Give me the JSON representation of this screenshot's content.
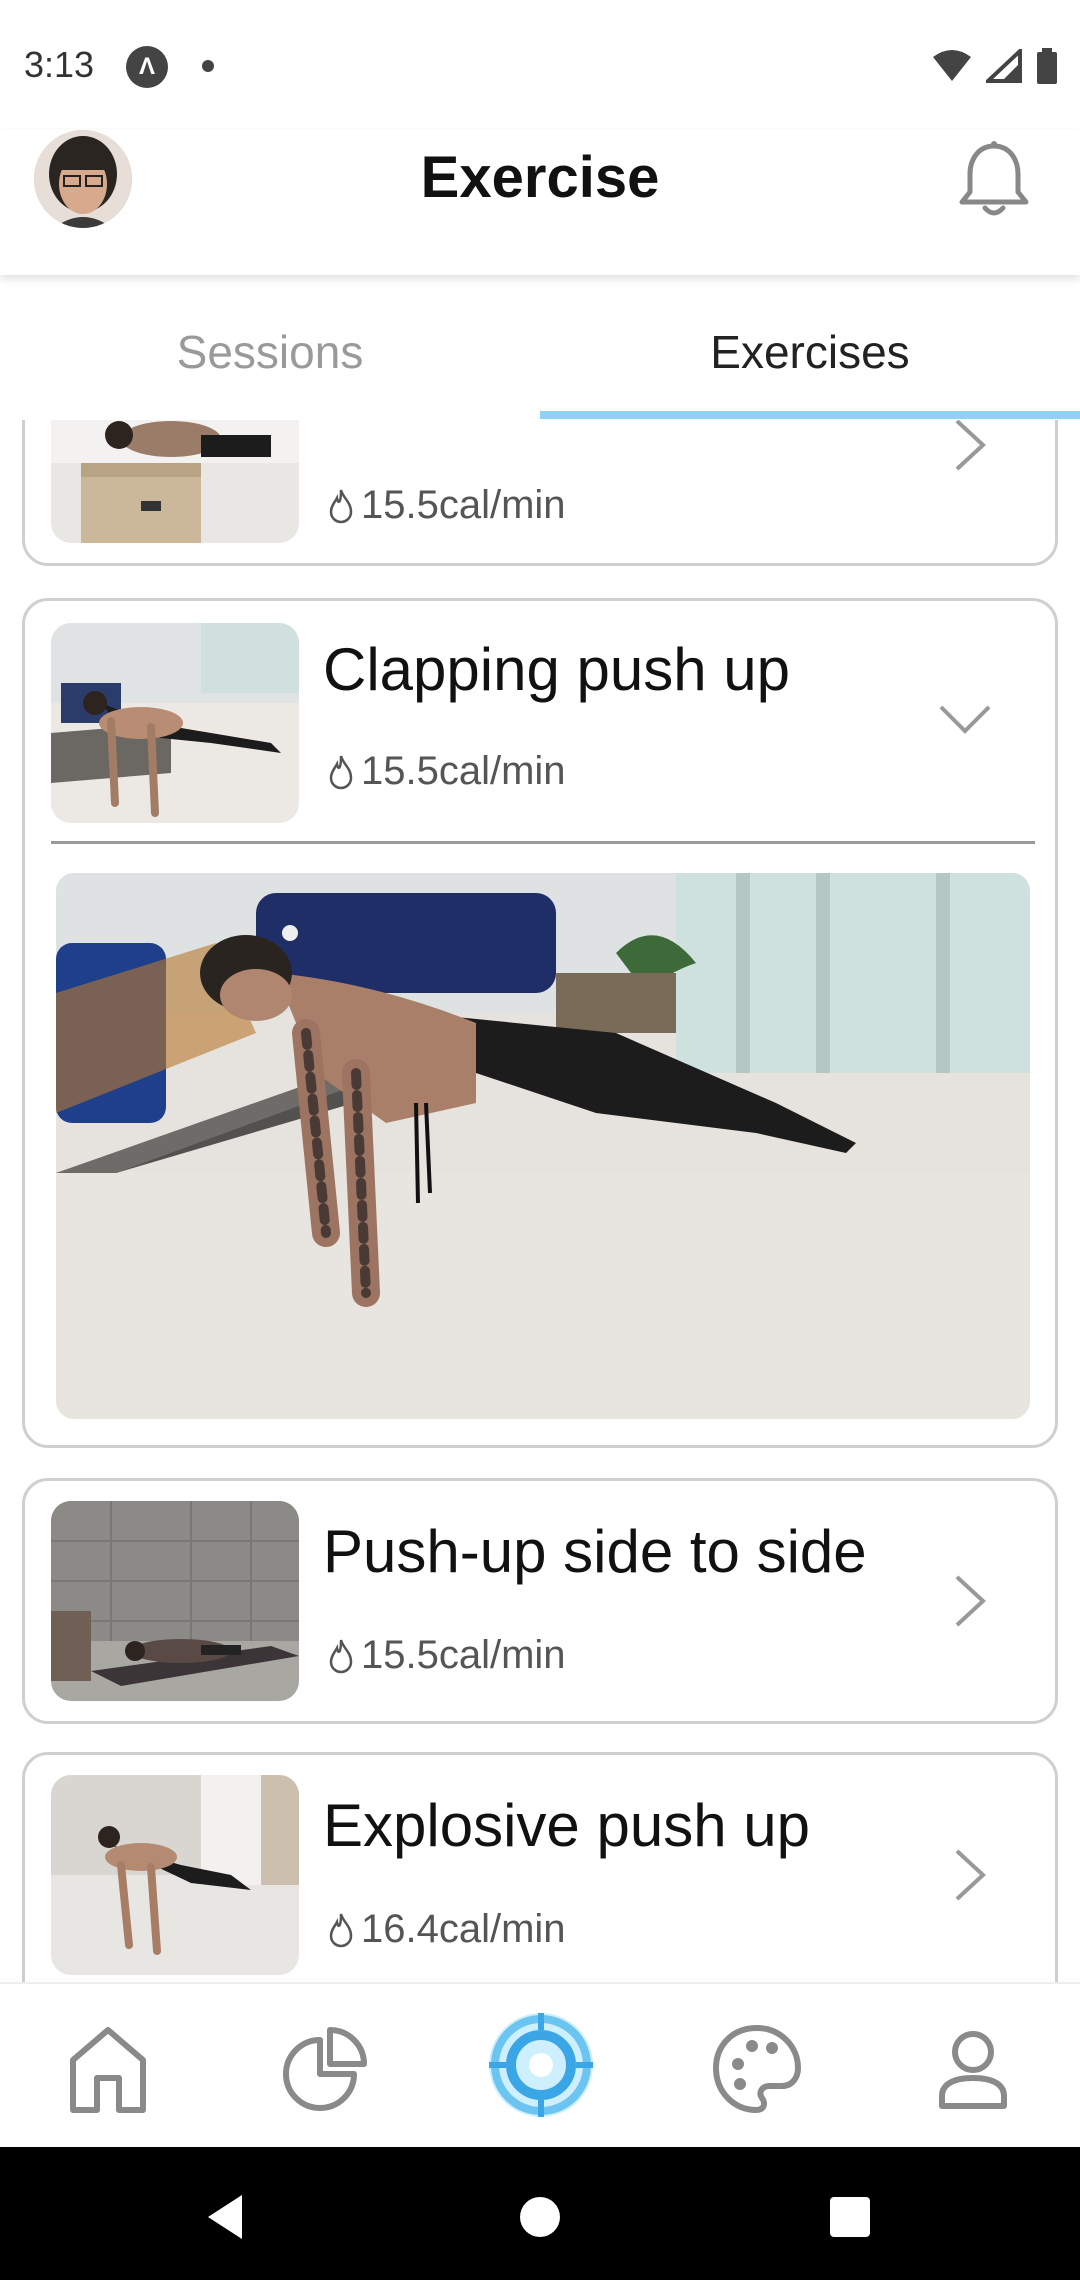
{
  "status_bar": {
    "time": "3:13",
    "app_icon_glyph": "Λ",
    "icons": [
      "wifi-icon",
      "signal-icon",
      "battery-icon"
    ]
  },
  "header": {
    "title": "Exercise",
    "avatar": "user-avatar",
    "bell_icon": "bell-icon"
  },
  "tabs": [
    {
      "label": "Sessions",
      "active": false
    },
    {
      "label": "Exercises",
      "active": true
    }
  ],
  "exercises": [
    {
      "name": "",
      "calories": "15.5cal/min",
      "state": "collapsed",
      "partially_visible": true
    },
    {
      "name": "Clapping push up",
      "calories": "15.5cal/min",
      "state": "expanded"
    },
    {
      "name": "Push-up side to side",
      "calories": "15.5cal/min",
      "state": "collapsed"
    },
    {
      "name": "Explosive push up",
      "calories": "16.4cal/min",
      "state": "collapsed"
    }
  ],
  "bottom_nav": [
    {
      "id": "home",
      "icon": "home-icon"
    },
    {
      "id": "stats",
      "icon": "pie-chart-icon"
    },
    {
      "id": "workout",
      "icon": "target-icon",
      "active": true
    },
    {
      "id": "palette",
      "icon": "palette-icon"
    },
    {
      "id": "profile",
      "icon": "person-icon"
    }
  ],
  "colors": {
    "accent": "#8fd3f4",
    "accent_strong": "#3aa6e6",
    "card_border": "#cfcfcf",
    "muted_text": "#9a9a9a"
  }
}
